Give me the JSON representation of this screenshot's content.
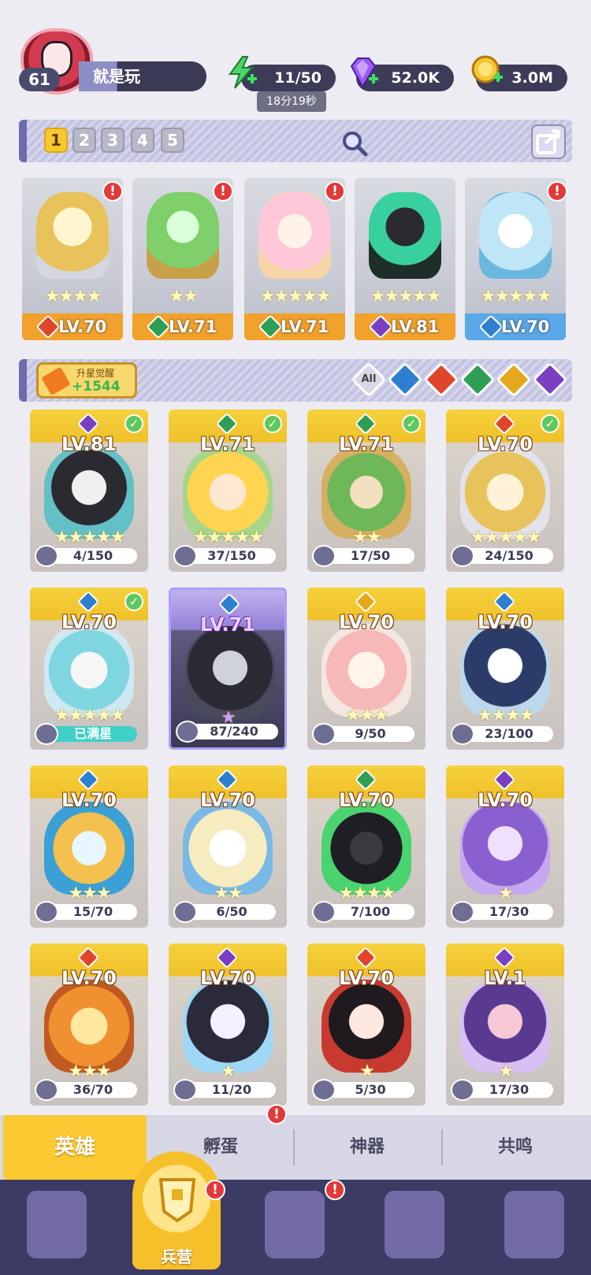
{
  "player": {
    "level": "61",
    "name": "就是玩"
  },
  "resources": {
    "energy": "11/50",
    "energy_timer": "18分19秒",
    "gems": "52.0K",
    "coins": "3.0M"
  },
  "team_tabs": [
    "1",
    "2",
    "3",
    "4",
    "5"
  ],
  "team_cards": [
    {
      "level": "LV.70",
      "element": "fire",
      "stars": "★★★★",
      "alert": "!"
    },
    {
      "level": "LV.71",
      "element": "wind",
      "stars": "★★",
      "alert": "!"
    },
    {
      "level": "LV.71",
      "element": "wind",
      "stars": "★★★★★",
      "alert": "!"
    },
    {
      "level": "LV.81",
      "element": "dark",
      "stars": "★★★★★",
      "alert": ""
    },
    {
      "level": "LV.70",
      "element": "water",
      "stars": "★★★★★",
      "alert": "!"
    }
  ],
  "star_up": {
    "label": "升星觉醒",
    "value": "+1544"
  },
  "filters": {
    "all": "All"
  },
  "heroes": [
    {
      "level": "LV.81",
      "progress": "4/150",
      "stars": "★★★★★",
      "element": "dark",
      "check": true
    },
    {
      "level": "LV.71",
      "progress": "37/150",
      "stars": "★★★★★",
      "element": "wind",
      "check": true
    },
    {
      "level": "LV.71",
      "progress": "17/50",
      "stars": "★★",
      "element": "wind",
      "check": true
    },
    {
      "level": "LV.70",
      "progress": "24/150",
      "stars": "★★★★★",
      "element": "fire",
      "check": true
    },
    {
      "level": "LV.70",
      "progress": "已满星",
      "stars": "★★★★★",
      "element": "water",
      "check": true
    },
    {
      "level": "LV.71",
      "progress": "87/240",
      "stars": "★",
      "element": "water",
      "check": false
    },
    {
      "level": "LV.70",
      "progress": "9/50",
      "stars": "★★★",
      "element": "light",
      "check": false
    },
    {
      "level": "LV.70",
      "progress": "23/100",
      "stars": "★★★★",
      "element": "water",
      "check": false
    },
    {
      "level": "LV.70",
      "progress": "15/70",
      "stars": "★★★",
      "element": "water",
      "check": false
    },
    {
      "level": "LV.70",
      "progress": "6/50",
      "stars": "★★",
      "element": "water",
      "check": false
    },
    {
      "level": "LV.70",
      "progress": "7/100",
      "stars": "★★★★",
      "element": "wind",
      "check": false
    },
    {
      "level": "LV.70",
      "progress": "17/30",
      "stars": "★",
      "element": "dark",
      "check": false
    },
    {
      "level": "LV.70",
      "progress": "36/70",
      "stars": "★★★",
      "element": "fire",
      "check": false
    },
    {
      "level": "LV.70",
      "progress": "11/20",
      "stars": "★",
      "element": "dark",
      "check": false
    },
    {
      "level": "LV.70",
      "progress": "5/30",
      "stars": "★",
      "element": "fire",
      "check": false
    },
    {
      "level": "LV.1",
      "progress": "17/30",
      "stars": "★",
      "element": "dark",
      "check": false
    }
  ],
  "bottom_tabs": [
    "英雄",
    "孵蛋",
    "神器",
    "共鸣"
  ],
  "nav": {
    "active_label": "兵营"
  },
  "colors": {
    "fire": "#e0452c",
    "wind": "#2f9e55",
    "dark": "#7a3fc2",
    "water": "#2e7fd0",
    "light": "#e5a81c"
  }
}
